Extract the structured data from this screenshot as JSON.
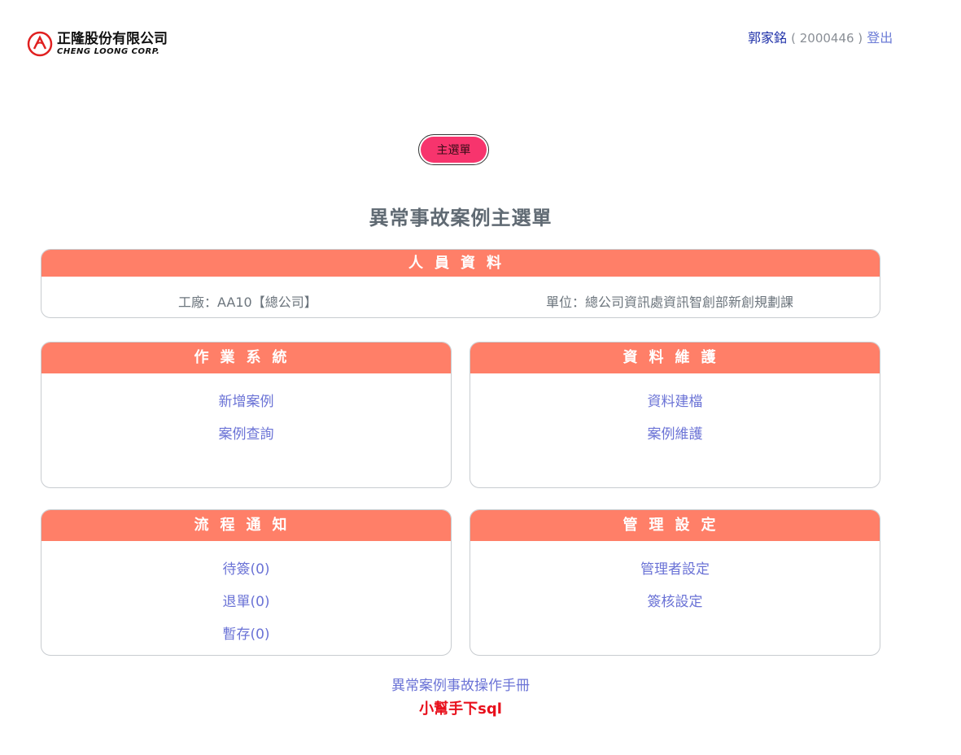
{
  "header": {
    "logo_cn": "正隆股份有限公司",
    "logo_en": "CHENG LOONG CORP.",
    "user_name": "郭家銘",
    "user_id": "( 2000446 )",
    "logout_label": "登出"
  },
  "main_menu_button": "主選單",
  "page_title": "異常事故案例主選單",
  "personnel": {
    "title": "人員資料",
    "factory": "工廠：AA10【總公司】",
    "unit": "單位：總公司資訊處資訊智創部新創規劃課"
  },
  "cards": {
    "operations": {
      "title": "作業系統",
      "links": [
        "新增案例",
        "案例查詢"
      ]
    },
    "data_maintenance": {
      "title": "資料維護",
      "links": [
        "資料建檔",
        "案例維護"
      ]
    },
    "workflow": {
      "title": "流程通知",
      "links": [
        "待簽(0)",
        "退單(0)",
        "暫存(0)"
      ]
    },
    "admin": {
      "title": "管理設定",
      "links": [
        "管理者設定",
        "簽核設定"
      ]
    }
  },
  "footer": {
    "manual_link": "異常案例事故操作手冊",
    "helper_link": "小幫手下sql"
  },
  "colors": {
    "card_header": "#ff7f68",
    "main_button": "#f7346d",
    "link": "#6b73d6",
    "helper_link": "#e8101c"
  }
}
